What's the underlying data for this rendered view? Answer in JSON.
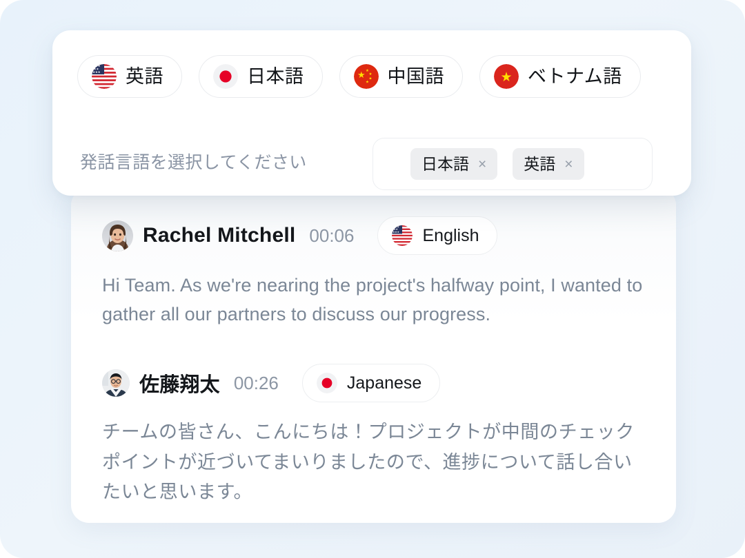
{
  "theme": {
    "page_background": "#eaf2fa",
    "card_background": "#ffffff",
    "muted_text": "#7b8796",
    "label_text": "#8a94a4",
    "tag_background": "#edeef0",
    "accent_red": "#e60026"
  },
  "language_panel": {
    "chips": [
      {
        "label": "英語",
        "flag": "us-flag-icon",
        "flag_name": "flag-united-states"
      },
      {
        "label": "日本語",
        "flag": "jp-flag-icon",
        "flag_name": "flag-japan"
      },
      {
        "label": "中国語",
        "flag": "cn-flag-icon",
        "flag_name": "flag-china"
      },
      {
        "label": "ベトナム語",
        "flag": "vn-flag-icon",
        "flag_name": "flag-vietnam"
      }
    ],
    "select_label": "発話言語を選択してください",
    "selected_tags": [
      {
        "label": "日本語",
        "remove_icon": "close-icon",
        "remove_glyph": "×"
      },
      {
        "label": "英語",
        "remove_icon": "close-icon",
        "remove_glyph": "×"
      }
    ]
  },
  "transcript": {
    "entries": [
      {
        "speaker": "Rachel Mitchell",
        "timestamp": "00:06",
        "language_badge": "English",
        "badge_flag": "us-flag-icon",
        "avatar": "avatar-rachel-mitchell",
        "message": "Hi Team. As we're nearing the project's halfway point, I wanted to gather all our partners to discuss our progress."
      },
      {
        "speaker": "佐藤翔太",
        "timestamp": "00:26",
        "language_badge": "Japanese",
        "badge_flag": "jp-flag-icon",
        "avatar": "avatar-sato-shota",
        "message": "チームの皆さん、こんにちは！プロジェクトが中間のチェックポイントが近づいてまいりましたので、進捗について話し合いたいと思います。"
      }
    ]
  }
}
